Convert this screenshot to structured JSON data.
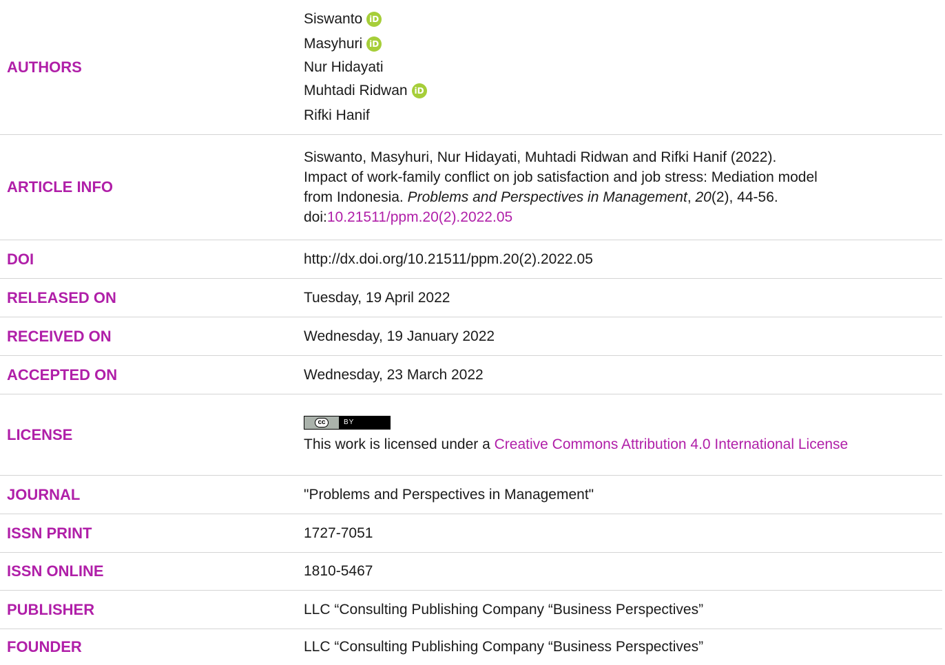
{
  "authors": {
    "label": "AUTHORS",
    "names": [
      "Siswanto",
      "Masyhuri",
      "Nur Hidayati",
      "Muhtadi Ridwan",
      "Rifki Hanif"
    ],
    "orcid_glyph": "iD",
    "orcid_color": "#a6ce39"
  },
  "article_info": {
    "label": "ARTICLE INFO",
    "line1": "Siswanto, Masyhuri, Nur Hidayati, Muhtadi Ridwan and Rifki Hanif (2022).",
    "line2": "Impact of work-family conflict on job satisfaction and job stress: Mediation model",
    "line3_pre": "from Indonesia. ",
    "journal_italic": "Problems and Perspectives in Management",
    "comma": ", ",
    "volume_italic": "20",
    "issue_pages": "(2), 44-56.",
    "doi_prefix": "doi:",
    "doi_link": "10.21511/ppm.20(2).2022.05"
  },
  "doi": {
    "label": "DOI",
    "value": "http://dx.doi.org/10.21511/ppm.20(2).2022.05"
  },
  "released": {
    "label": "RELEASED ON",
    "value": "Tuesday, 19 April 2022"
  },
  "received": {
    "label": "RECEIVED ON",
    "value": "Wednesday, 19 January 2022"
  },
  "accepted": {
    "label": "ACCEPTED ON",
    "value": "Wednesday, 23 March 2022"
  },
  "license": {
    "label": "LICENSE",
    "badge_left": "cc",
    "badge_right": "BY",
    "text": "This work is licensed under a ",
    "link": "Creative Commons Attribution 4.0 International License"
  },
  "journal": {
    "label": "JOURNAL",
    "value": "\"Problems and Perspectives in Management\""
  },
  "issn_print": {
    "label": "ISSN PRINT",
    "value": "1727-7051"
  },
  "issn_online": {
    "label": "ISSN ONLINE",
    "value": "1810-5467"
  },
  "publisher": {
    "label": "PUBLISHER",
    "value": "LLC “Consulting Publishing Company “Business Perspectives”"
  },
  "founder": {
    "label": "FOUNDER",
    "value": "LLC “Consulting Publishing Company “Business Perspectives”"
  },
  "colors": {
    "accent": "#b01fa8",
    "text": "#1a1a1a",
    "rule": "#d4d4d4"
  }
}
